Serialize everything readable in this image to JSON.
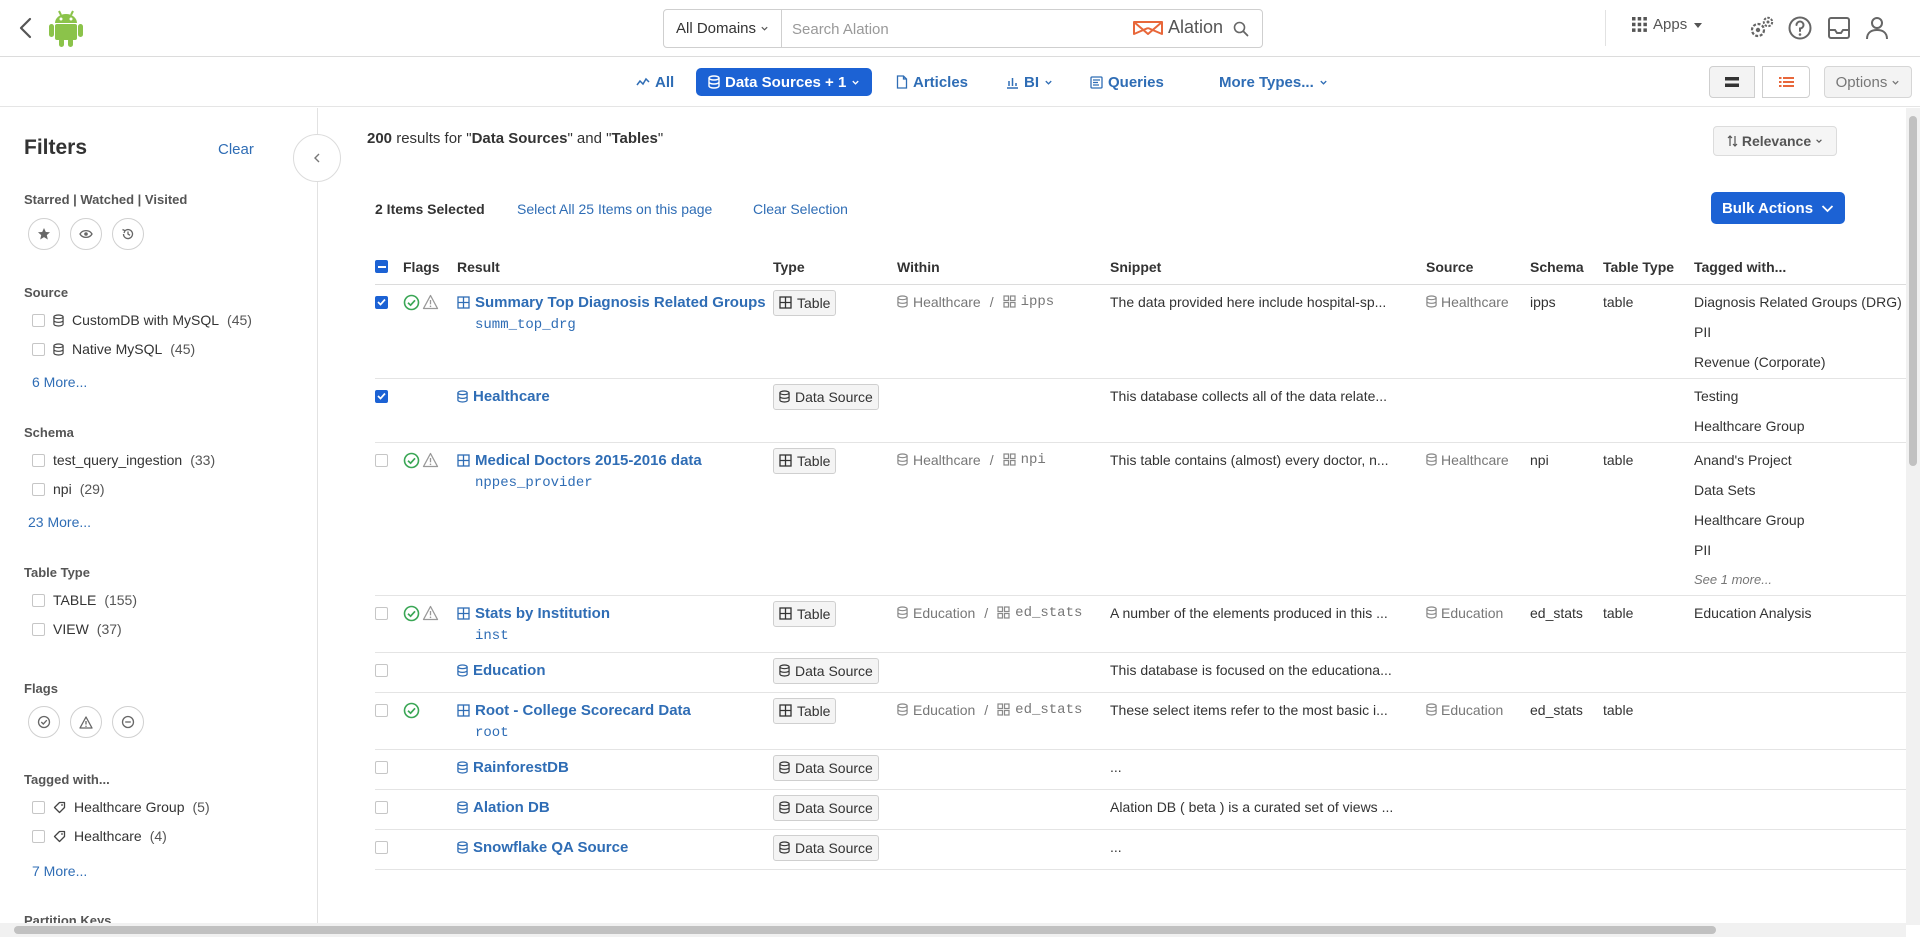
{
  "topbar": {
    "domain_select": "All Domains",
    "search_placeholder": "Search Alation",
    "brand": "Alation",
    "apps_label": "Apps"
  },
  "typebar": {
    "tabs": [
      {
        "label": "All",
        "icon": "activity-icon"
      },
      {
        "label": "Data Sources + 1",
        "icon": "database-icon",
        "active": true
      },
      {
        "label": "Articles",
        "icon": "document-icon"
      },
      {
        "label": "BI",
        "icon": "bar-chart-icon"
      },
      {
        "label": "Queries",
        "icon": "query-icon"
      },
      {
        "label": "More Types...",
        "icon": "chevron-down-icon"
      }
    ],
    "options_label": "Options"
  },
  "sidebar": {
    "title": "Filters",
    "clear": "Clear",
    "sections": {
      "starred": {
        "title": "Starred | Watched | Visited"
      },
      "source": {
        "title": "Source",
        "items": [
          {
            "label": "CustomDB with MySQL",
            "count": "(45)"
          },
          {
            "label": "Native MySQL",
            "count": "(45)"
          }
        ],
        "more": "6 More..."
      },
      "schema": {
        "title": "Schema",
        "items": [
          {
            "label": "test_query_ingestion",
            "count": "(33)"
          },
          {
            "label": "npi",
            "count": "(29)"
          }
        ],
        "more": "23 More..."
      },
      "table_type": {
        "title": "Table Type",
        "items": [
          {
            "label": "TABLE",
            "count": "(155)"
          },
          {
            "label": "VIEW",
            "count": "(37)"
          }
        ]
      },
      "flags": {
        "title": "Flags"
      },
      "tagged": {
        "title": "Tagged with...",
        "items": [
          {
            "label": "Healthcare Group",
            "count": "(5)"
          },
          {
            "label": "Healthcare",
            "count": "(4)"
          }
        ],
        "more": "7 More..."
      },
      "partition": {
        "title": "Partition Keys"
      }
    }
  },
  "main": {
    "results": {
      "count": "200",
      "mid": "results for \"",
      "type1": "Data Sources",
      "and": "\" and \"",
      "type2": "Tables",
      "end": "\""
    },
    "sort_label": "Relevance",
    "selected_count": "2 Items Selected",
    "select_all": "Select All 25 Items on this page",
    "clear_selection": "Clear Selection",
    "bulk_actions": "Bulk Actions",
    "columns": {
      "flags": "Flags",
      "result": "Result",
      "type": "Type",
      "within": "Within",
      "snippet": "Snippet",
      "source": "Source",
      "schema": "Schema",
      "table_type": "Table Type",
      "tagged": "Tagged with..."
    },
    "rows": [
      {
        "checked": true,
        "flags": [
          "check",
          "warn"
        ],
        "title": "Summary Top Diagnosis Related Groups",
        "icon": "table",
        "sub": "summ_top_drg",
        "type": "Table",
        "within_ds": "Healthcare",
        "within_schema": "ipps",
        "snippet": "The data provided here include hospital-sp...",
        "source": "Healthcare",
        "schema": "ipps",
        "table_type": "table",
        "tags": [
          "Diagnosis Related Groups (DRG)",
          "PII",
          "Revenue (Corporate)"
        ],
        "see_more": ""
      },
      {
        "checked": true,
        "flags": [],
        "title": "Healthcare",
        "icon": "db",
        "sub": "",
        "type": "Data Source",
        "within_ds": "",
        "within_schema": "",
        "snippet": "This database collects all of the data relate...",
        "source": "",
        "schema": "",
        "table_type": "",
        "tags": [
          "Testing",
          "Healthcare Group"
        ],
        "see_more": ""
      },
      {
        "checked": false,
        "flags": [
          "check",
          "warn"
        ],
        "title": "Medical Doctors 2015-2016 data",
        "icon": "table",
        "sub": "nppes_provider",
        "type": "Table",
        "within_ds": "Healthcare",
        "within_schema": "npi",
        "snippet": "This table contains (almost) every doctor, n...",
        "source": "Healthcare",
        "schema": "npi",
        "table_type": "table",
        "tags": [
          "Anand's Project",
          "Data Sets",
          "Healthcare Group",
          "PII"
        ],
        "see_more": "See 1 more..."
      },
      {
        "checked": false,
        "flags": [
          "check",
          "warn"
        ],
        "title": "Stats by Institution",
        "icon": "table",
        "sub": "inst",
        "type": "Table",
        "within_ds": "Education",
        "within_schema": "ed_stats",
        "snippet": "A number of the elements produced in this ...",
        "source": "Education",
        "schema": "ed_stats",
        "table_type": "table",
        "tags": [
          "Education Analysis"
        ],
        "see_more": ""
      },
      {
        "checked": false,
        "flags": [],
        "title": "Education",
        "icon": "db",
        "sub": "",
        "type": "Data Source",
        "within_ds": "",
        "within_schema": "",
        "snippet": "This database is focused on the educationa...",
        "source": "",
        "schema": "",
        "table_type": "",
        "tags": [],
        "see_more": ""
      },
      {
        "checked": false,
        "flags": [
          "check"
        ],
        "title": "Root - College Scorecard Data",
        "icon": "table",
        "sub": "root",
        "type": "Table",
        "within_ds": "Education",
        "within_schema": "ed_stats",
        "snippet": "These select items refer to the most basic i...",
        "source": "Education",
        "schema": "ed_stats",
        "table_type": "table",
        "tags": [],
        "see_more": ""
      },
      {
        "checked": false,
        "flags": [],
        "title": "RainforestDB",
        "icon": "db",
        "sub": "",
        "type": "Data Source",
        "within_ds": "",
        "within_schema": "",
        "snippet": "...",
        "source": "",
        "schema": "",
        "table_type": "",
        "tags": [],
        "see_more": ""
      },
      {
        "checked": false,
        "flags": [],
        "title": "Alation DB",
        "icon": "db",
        "sub": "",
        "type": "Data Source",
        "within_ds": "",
        "within_schema": "",
        "snippet": "Alation DB ( beta ) is a curated set of views ...",
        "source": "",
        "schema": "",
        "table_type": "",
        "tags": [],
        "see_more": ""
      },
      {
        "checked": false,
        "flags": [],
        "title": "Snowflake QA Source",
        "icon": "db",
        "sub": "",
        "type": "Data Source",
        "within_ds": "",
        "within_schema": "",
        "snippet": "...",
        "source": "",
        "schema": "",
        "table_type": "",
        "tags": [],
        "see_more": ""
      }
    ]
  },
  "colors": {
    "accent": "#1c62d4",
    "link": "#2f6db5",
    "success": "#3aa655",
    "android": "#8bc34a"
  }
}
